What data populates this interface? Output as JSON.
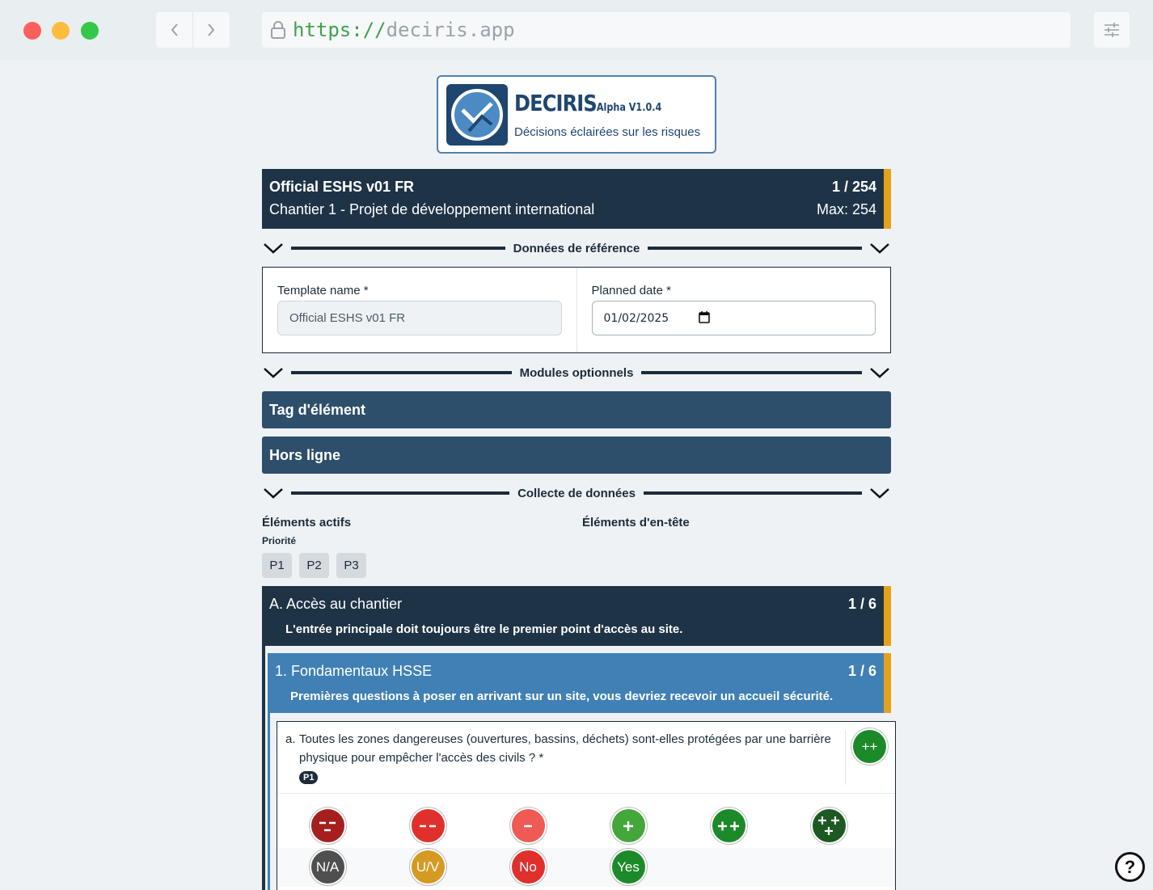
{
  "browser": {
    "url_scheme": "https://",
    "url_host": "deciris.app"
  },
  "logo": {
    "brand": "DECIRIS",
    "version": "Alpha V1.0.4",
    "tagline": "Décisions éclairées sur les risques"
  },
  "header": {
    "template": "Official ESHS v01 FR",
    "site": "Chantier 1 - Projet de développement international",
    "progress": "1 / 254",
    "max": "Max: 254"
  },
  "sections": {
    "reference": "Données de référence",
    "modules": "Modules optionnels",
    "collection": "Collecte de données"
  },
  "reference": {
    "template_label": "Template name *",
    "template_value": "Official ESHS v01 FR",
    "date_label": "Planned date *",
    "date_value": "01/02/2025"
  },
  "modules": [
    "Tag d'élément",
    "Hors ligne"
  ],
  "collection": {
    "active_label": "Éléments actifs",
    "header_label": "Éléments d'en-tête",
    "priority_label": "Priorité",
    "priorities": [
      "P1",
      "P2",
      "P3"
    ]
  },
  "section_a": {
    "title": "A. Accès au chantier",
    "count": "1 / 6",
    "description": "L'entrée principale doit toujours être le premier point d'accès au site."
  },
  "subsection_1": {
    "title": "1. Fondamentaux HSSE",
    "count": "1 / 6",
    "description": "Premières questions à poser en arrivant sur un site, vous devriez recevoir un accueil sécurité."
  },
  "question": {
    "letter": "a.",
    "text": "Toutes les zones dangereuses (ouvertures, bassins, déchets) sont-elles protégées par une barrière physique pour empêcher l'accès des civils ? *",
    "priority": "P1",
    "selected": "++"
  },
  "responses": {
    "row1": [
      {
        "label": "---",
        "color": "#a51f1f"
      },
      {
        "label": "--",
        "color": "#e0302c"
      },
      {
        "label": "-",
        "color": "#f05a55"
      },
      {
        "label": "+",
        "color": "#45a63c"
      },
      {
        "label": "++",
        "color": "#1d8a2a"
      },
      {
        "label": "+++",
        "color": "#1c5a22"
      }
    ],
    "row2": [
      {
        "label": "N/A",
        "color": "#4f4f4f"
      },
      {
        "label": "U/V",
        "color": "#d49a22"
      },
      {
        "label": "No",
        "color": "#e0302c"
      },
      {
        "label": "Yes",
        "color": "#1d8a2a"
      }
    ]
  },
  "help": "?"
}
